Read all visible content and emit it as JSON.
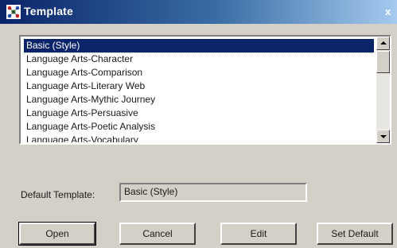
{
  "window": {
    "title": "Template",
    "close_glyph": "x",
    "icon": "template-app-icon"
  },
  "template_list": {
    "selected_index": 0,
    "items": [
      {
        "label": "Basic (Style)"
      },
      {
        "label": "Language Arts-Character"
      },
      {
        "label": "Language Arts-Comparison"
      },
      {
        "label": "Language Arts-Literary Web"
      },
      {
        "label": "Language Arts-Mythic Journey"
      },
      {
        "label": "Language Arts-Persuasive"
      },
      {
        "label": "Language Arts-Poetic Analysis"
      },
      {
        "label": "Language Arts-Vocabulary"
      }
    ]
  },
  "default_template": {
    "label": "Default Template:",
    "value": "Basic (Style)"
  },
  "buttons": {
    "open": "Open",
    "cancel": "Cancel",
    "edit": "Edit",
    "set_default": "Set Default"
  },
  "colors": {
    "titlebar_start": "#0a246a",
    "selection": "#0a246a",
    "face": "#d4d0c8"
  }
}
